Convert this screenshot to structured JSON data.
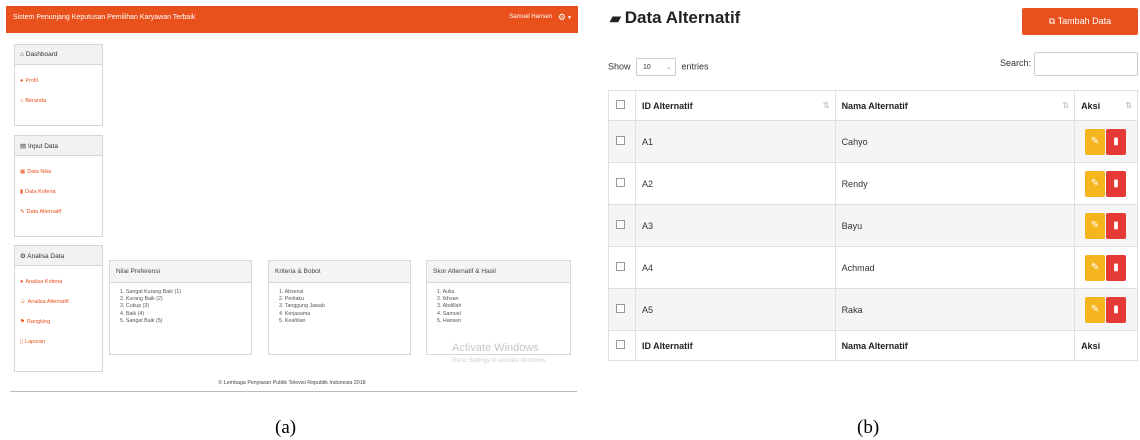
{
  "panel_a": {
    "app_title": "Sistem Penunjang Keputusan Pemilihan Karyawan Terbaik",
    "user_name": "Samuel Hansen",
    "sidebar": [
      {
        "heading_icon": "home-icon",
        "heading": "Dashboard",
        "items": [
          {
            "icon": "user-icon",
            "label": "Profil"
          },
          {
            "icon": "home-icon",
            "label": "Beranda"
          }
        ]
      },
      {
        "heading_icon": "file-icon",
        "heading": "Input Data",
        "items": [
          {
            "icon": "table-icon",
            "label": "Data Nilai"
          },
          {
            "icon": "trash-icon",
            "label": "Data Kriteria"
          },
          {
            "icon": "pencil-icon",
            "label": "Data Alternatif"
          }
        ]
      },
      {
        "heading_icon": "gears-icon",
        "heading": "Analisa Data",
        "items": [
          {
            "icon": "bullet-icon",
            "label": "Analisa Kriteria"
          },
          {
            "icon": "users-icon",
            "label": "Analisa Alternatif"
          },
          {
            "icon": "flag-icon",
            "label": "Rangking"
          },
          {
            "icon": "document-icon",
            "label": "Laporan"
          }
        ]
      }
    ],
    "cards": [
      {
        "title": "Nilai Preferensi",
        "items": [
          "1. Sangat Kurang Baik (1)",
          "2. Kurang Baik (2)",
          "3. Cukup (3)",
          "4. Baik (4)",
          "5. Sangat Baik (5)"
        ]
      },
      {
        "title": "Kriteria & Bobot",
        "items": [
          "1. Absensi",
          "2. Perilaku",
          "3. Tanggung Jawab",
          "4. Kerjasama",
          "5. Keahlian"
        ]
      },
      {
        "title": "Skor Alternatif & Hasil",
        "items": [
          "1. Aulia",
          "2. Ikhsan",
          "3. Abdillah",
          "4. Samuel",
          "5. Hansen"
        ]
      }
    ],
    "watermark_title": "Activate Windows",
    "watermark_sub": "Go to Settings to activate Windows.",
    "footer": "© Lembaga Penyiaran Publik Televisi Republik Indonesia 2018",
    "label": "(a)"
  },
  "panel_b": {
    "title": "Data Alternatif",
    "add_button": "Tambah Data",
    "show_label": "Show",
    "entries_value": "10",
    "entries_label": "entries",
    "search_label": "Search:",
    "columns": [
      "ID Alternatif",
      "Nama Alternatif",
      "Aksi"
    ],
    "rows": [
      {
        "id": "A1",
        "name": "Cahyo"
      },
      {
        "id": "A2",
        "name": "Rendy"
      },
      {
        "id": "A3",
        "name": "Bayu"
      },
      {
        "id": "A4",
        "name": "Achmad"
      },
      {
        "id": "A5",
        "name": "Raka"
      }
    ],
    "label": "(b)"
  },
  "colors": {
    "accent": "#e8501c",
    "edit": "#f5b51e",
    "delete": "#e53935"
  }
}
